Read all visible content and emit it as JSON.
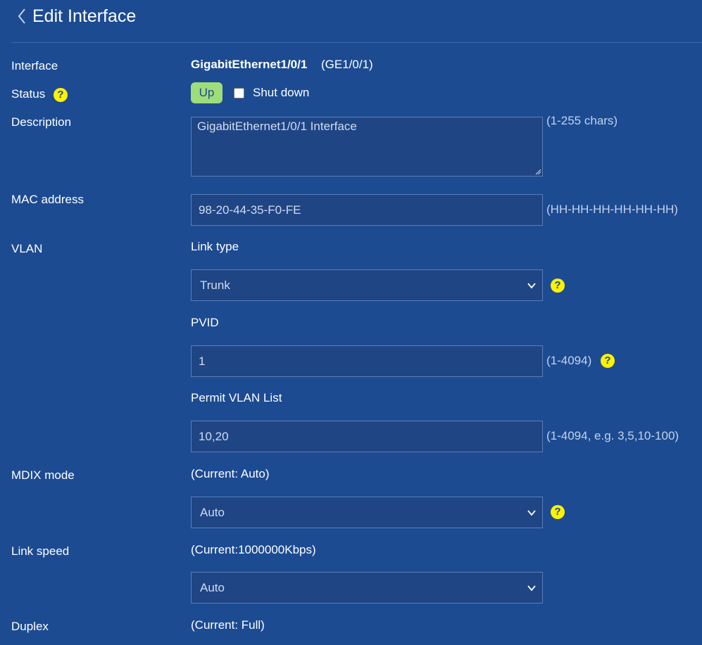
{
  "header": {
    "title": "Edit Interface"
  },
  "interface": {
    "label": "Interface",
    "name": "GigabitEthernet1/0/1",
    "short": "(GE1/0/1)"
  },
  "status": {
    "label": "Status",
    "state": "Up",
    "shutdown_label": "Shut down",
    "shutdown_checked": false
  },
  "description": {
    "label": "Description",
    "value": "GigabitEthernet1/0/1 Interface",
    "hint": "(1-255 chars)"
  },
  "mac": {
    "label": "MAC address",
    "value": "98-20-44-35-F0-FE",
    "hint": "(HH-HH-HH-HH-HH-HH)"
  },
  "vlan": {
    "label": "VLAN",
    "link_type_label": "Link type",
    "link_type": "Trunk",
    "pvid_label": "PVID",
    "pvid": "1",
    "pvid_hint": "(1-4094)",
    "permit_label": "Permit VLAN List",
    "permit": "10,20",
    "permit_hint": "(1-4094, e.g. 3,5,10-100)"
  },
  "mdix": {
    "label": "MDIX mode",
    "current": "(Current: Auto)",
    "value": "Auto"
  },
  "speed": {
    "label": "Link speed",
    "current": "(Current:1000000Kbps)",
    "value": "Auto"
  },
  "duplex": {
    "label": "Duplex",
    "current": "(Current: Full)"
  },
  "help_glyph": "?",
  "colors": {
    "background": "#1c4b92",
    "help": "#fff200",
    "up_badge": "#9fdc7a",
    "field": "#1f4585"
  }
}
